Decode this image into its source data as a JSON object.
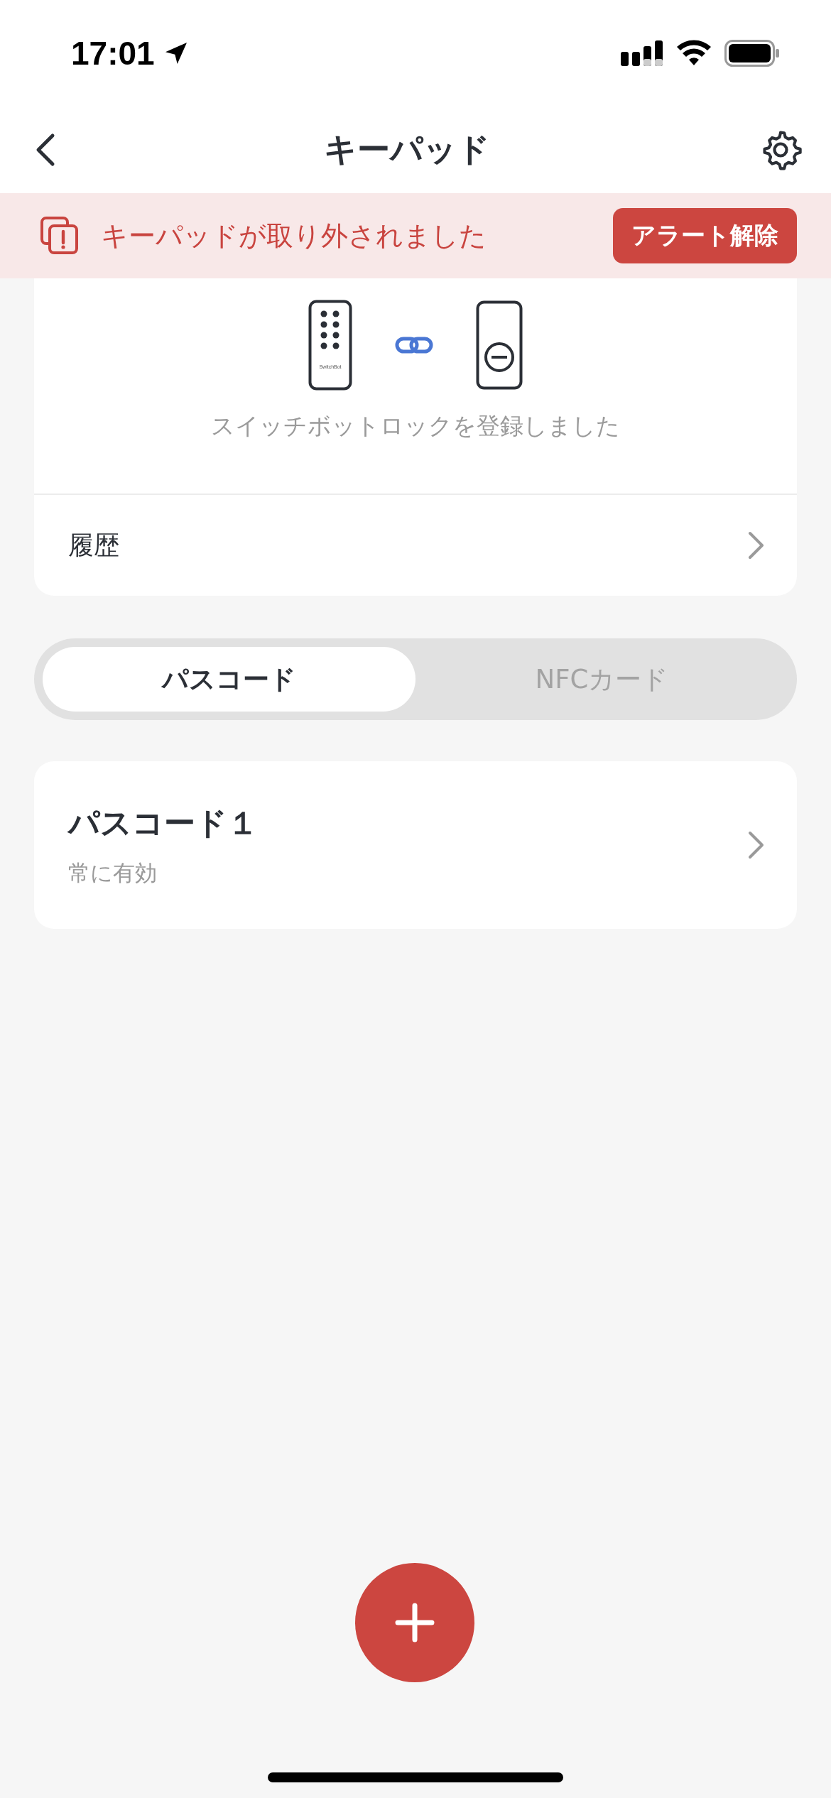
{
  "status_bar": {
    "time": "17:01"
  },
  "header": {
    "title": "キーパッド"
  },
  "alert": {
    "message": "キーパッドが取り外されました",
    "button": "アラート解除"
  },
  "device_card": {
    "keypad_brand": "SwitchBot",
    "caption": "スイッチボットロックを登録しました",
    "history_label": "履歴"
  },
  "tabs": [
    {
      "label": "パスコード",
      "selected": true
    },
    {
      "label": "NFCカード",
      "selected": false
    }
  ],
  "passcodes": [
    {
      "name": "パスコード１",
      "validity": "常に有効"
    }
  ]
}
